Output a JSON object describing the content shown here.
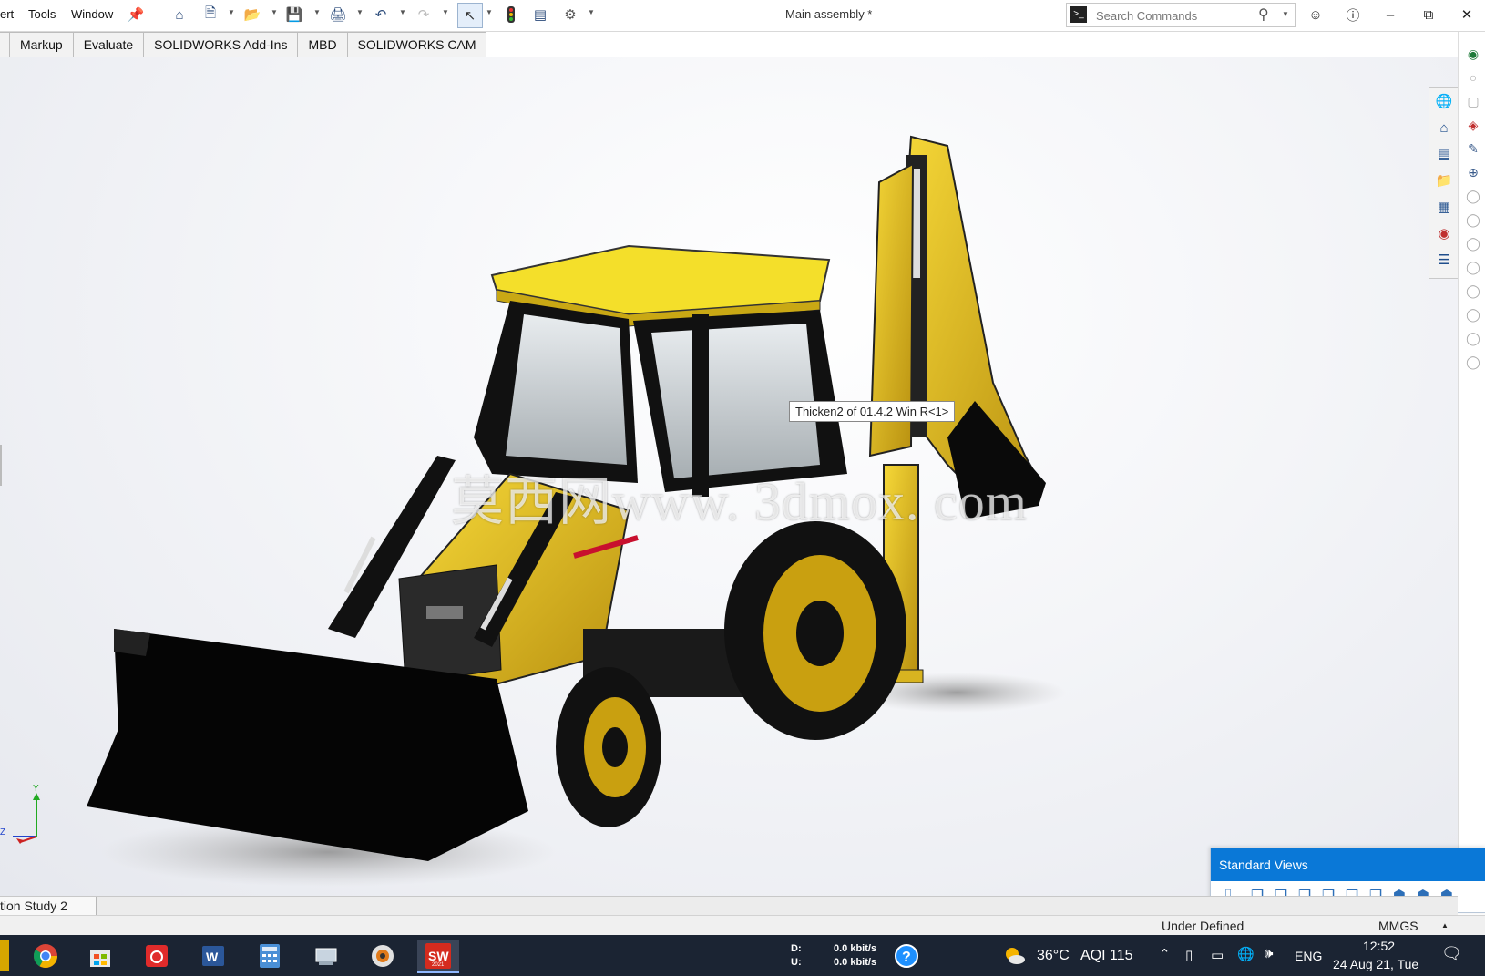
{
  "titlebar": {
    "menus": [
      "ert",
      "Tools",
      "Window"
    ],
    "document_title": "Main assembly *",
    "search_placeholder": "Search Commands"
  },
  "command_tabs": [
    "",
    "Markup",
    "Evaluate",
    "SOLIDWORKS Add-Ins",
    "MBD",
    "SOLIDWORKS CAM"
  ],
  "viewport": {
    "tooltip": "Thicken2 of 01.4.2 Win R<1>",
    "watermark": "莫西网www. 3dmox. com",
    "triad_axis_y": "Y",
    "triad_axis_z": "Z"
  },
  "standard_views": {
    "title": "Standard Views",
    "views": [
      "normal-to-icon",
      "front-view-icon",
      "back-view-icon",
      "left-view-icon",
      "right-view-icon",
      "top-view-icon",
      "bottom-view-icon",
      "isometric-view-icon",
      "trimetric-view-icon",
      "dimetric-view-icon"
    ]
  },
  "bottom_tab": "tion Study 2",
  "status_bar": {
    "state": "Under Defined",
    "units": "MMGS"
  },
  "taskbar": {
    "net_down_label": "D:",
    "net_up_label": "U:",
    "net_down": "0.0 kbit/s",
    "net_up": "0.0 kbit/s",
    "weather_temp": "36°C",
    "aqi": "AQI 115",
    "language": "ENG",
    "time": "12:52",
    "date": "24 Aug 21, Tue",
    "sw_badge": "2021"
  },
  "colors": {
    "body_yellow": "#e8c21a",
    "dark_yellow": "#a07f10",
    "black": "#0a0a0a",
    "accent_blue": "#0a78d7"
  }
}
